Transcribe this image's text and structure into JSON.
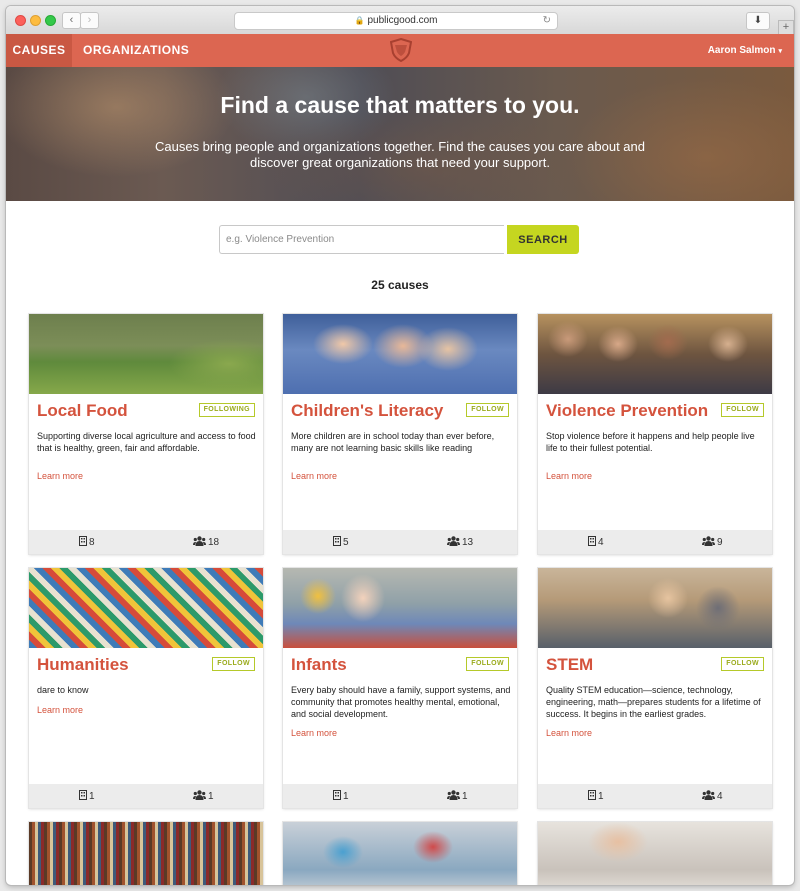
{
  "browser": {
    "url": "publicgood.com"
  },
  "nav": {
    "causes_label": "CAUSES",
    "organizations_label": "ORGANIZATIONS",
    "user_name": "Aaron Salmon",
    "caret": "▾"
  },
  "hero": {
    "title": "Find a cause that matters to you.",
    "subtitle": "Causes bring people and organizations together. Find the causes you care about and discover great organizations that need your support."
  },
  "search": {
    "placeholder": "e.g. Violence Prevention",
    "button_label": "SEARCH"
  },
  "results": {
    "count_label": "25 causes"
  },
  "cards": [
    {
      "title": "Local Food",
      "follow_label": "FOLLOWING",
      "description": "Supporting diverse local agriculture and access to food that is healthy, green, fair and affordable.",
      "learn_more": "Learn more",
      "organizations": "8",
      "followers": "18"
    },
    {
      "title": "Children's Literacy",
      "follow_label": "FOLLOW",
      "description": "More children are in school today than ever before, many are not learning basic skills like reading",
      "learn_more": "Learn more",
      "organizations": "5",
      "followers": "13"
    },
    {
      "title": "Violence Prevention",
      "follow_label": "FOLLOW",
      "description": "Stop violence before it happens and help people live life to their fullest potential.",
      "learn_more": "Learn more",
      "organizations": "4",
      "followers": "9"
    },
    {
      "title": "Humanities",
      "follow_label": "FOLLOW",
      "description": "dare to know",
      "learn_more": "Learn more",
      "organizations": "1",
      "followers": "1"
    },
    {
      "title": "Infants",
      "follow_label": "FOLLOW",
      "description": "Every baby should have a family, support systems, and community that promotes healthy mental, emotional, and social development.",
      "learn_more": "Learn more",
      "organizations": "1",
      "followers": "1"
    },
    {
      "title": "STEM",
      "follow_label": "FOLLOW",
      "description": "Quality STEM education—science, technology, engineering, math—prepares students for a lifetime of success. It begins in the earliest grades.",
      "learn_more": "Learn more",
      "organizations": "1",
      "followers": "4"
    }
  ],
  "icons": {
    "organizations": "building-icon",
    "followers": "people-icon"
  },
  "colors": {
    "brand": "#dc6651",
    "brand_dark": "#c95843",
    "accent": "#c5d620",
    "title": "#d4533d"
  }
}
